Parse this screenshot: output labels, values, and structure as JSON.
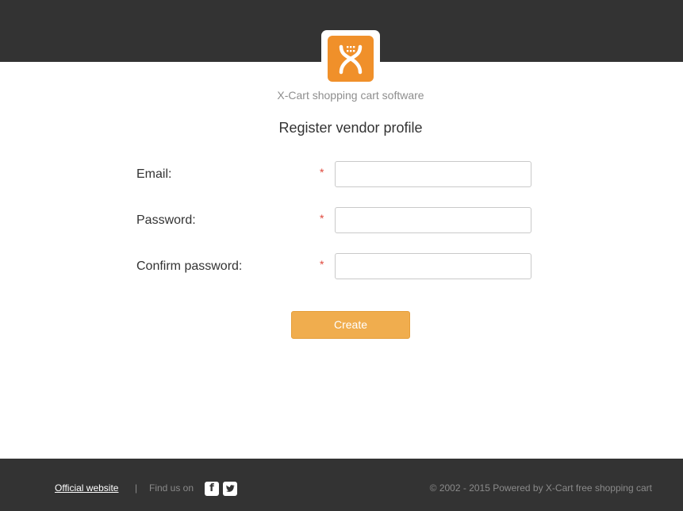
{
  "header": {
    "tagline": "X-Cart shopping cart software"
  },
  "form": {
    "title": "Register vendor profile",
    "fields": [
      {
        "label": "Email:",
        "required_mark": "*",
        "value": ""
      },
      {
        "label": "Password:",
        "required_mark": "*",
        "value": ""
      },
      {
        "label": "Confirm password:",
        "required_mark": "*",
        "value": ""
      }
    ],
    "submit_label": "Create"
  },
  "footer": {
    "official_link": "Official website",
    "separator": "|",
    "find_us": "Find us on",
    "social": [
      {
        "icon": "facebook-icon",
        "glyph": "f"
      },
      {
        "icon": "twitter-icon",
        "glyph": "t"
      }
    ],
    "copyright": "© 2002 - 2015 Powered by X-Cart free shopping cart"
  },
  "colors": {
    "header_bg": "#333333",
    "logo_orange": "#f0902a",
    "button_bg": "#f0ad4e",
    "required_star": "#e0483c"
  }
}
